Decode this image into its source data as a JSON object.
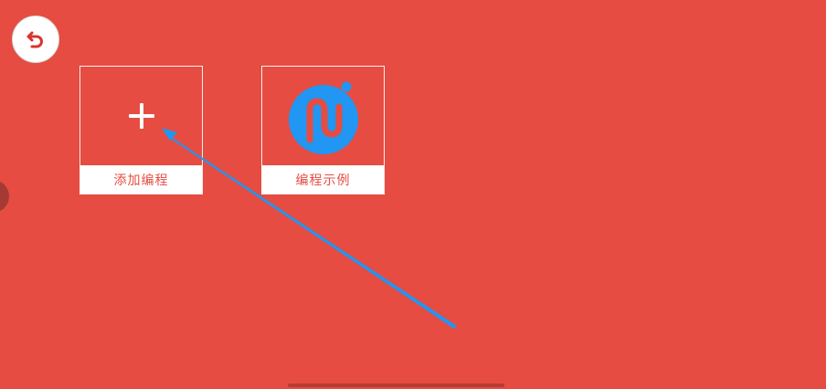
{
  "toolbar": {
    "back_icon": "undo-icon",
    "back_color": "#d9342b"
  },
  "cards": [
    {
      "label": "添加编程",
      "icon": "plus-icon"
    },
    {
      "label": "编程示例",
      "icon": "app-logo-icon",
      "icon_color": "#2196f3"
    }
  ],
  "theme": {
    "background": "#e64c41",
    "card_label_bg": "#ffffff",
    "card_label_text": "#e64c41",
    "annotation_arrow": "#2196f3"
  }
}
